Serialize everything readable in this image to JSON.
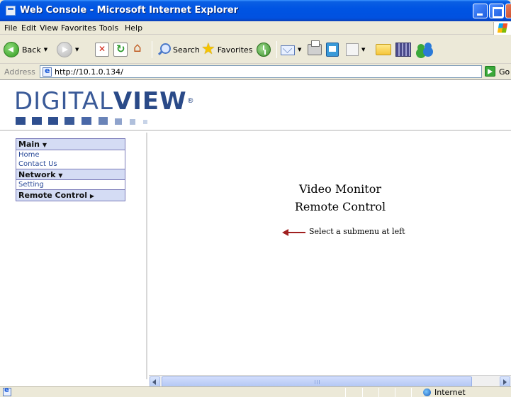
{
  "window": {
    "title": "Web Console - Microsoft Internet Explorer"
  },
  "menubar": {
    "items": [
      "File",
      "Edit",
      "View",
      "Favorites",
      "Tools",
      "Help"
    ]
  },
  "toolbar": {
    "back_label": "Back",
    "search_label": "Search",
    "favorites_label": "Favorites"
  },
  "address": {
    "label": "Address",
    "url": "http://10.1.0.134/",
    "go_label": "Go"
  },
  "logo": {
    "thin": "DIGITAL",
    "bold": "VIEW",
    "mark": "®",
    "color_dark": "#2f4f8f",
    "color_light": "#8fa3cc"
  },
  "sidebar": {
    "main_label": "Main",
    "main_items": [
      "Home",
      "Contact Us"
    ],
    "network_label": "Network",
    "network_items": [
      "Setting"
    ],
    "remote_label": "Remote Control"
  },
  "main": {
    "title_line1": "Video Monitor",
    "title_line2": "Remote Control",
    "hint": "Select a submenu at left",
    "arrow_color": "#a02020"
  },
  "status": {
    "zone": "Internet"
  }
}
